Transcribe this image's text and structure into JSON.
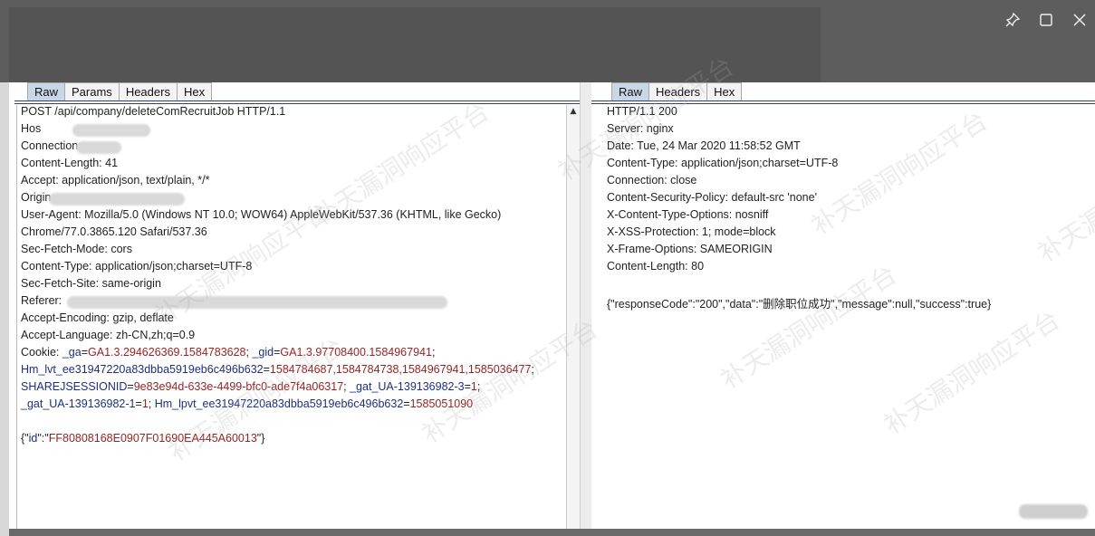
{
  "request_tabs": [
    "Raw",
    "Params",
    "Headers",
    "Hex"
  ],
  "response_tabs": [
    "Raw",
    "Headers",
    "Hex"
  ],
  "request_lines": [
    [
      {
        "t": "POST /api/company/deleteComRecruitJob HTTP/1.1"
      }
    ],
    [
      {
        "t": "Hos"
      }
    ],
    [
      {
        "t": "Connection:"
      }
    ],
    [
      {
        "t": "Content-Length: 41"
      }
    ],
    [
      {
        "t": "Accept: application/json, text/plain, */*"
      }
    ],
    [
      {
        "t": "Origin"
      }
    ],
    [
      {
        "t": "User-Agent: Mozilla/5.0 (Windows NT 10.0; WOW64) AppleWebKit/537.36 (KHTML, like Gecko)"
      }
    ],
    [
      {
        "t": "Chrome/77.0.3865.120 Safari/537.36"
      }
    ],
    [
      {
        "t": "Sec-Fetch-Mode: cors"
      }
    ],
    [
      {
        "t": "Content-Type: application/json;charset=UTF-8"
      }
    ],
    [
      {
        "t": "Sec-Fetch-Site: same-origin"
      }
    ],
    [
      {
        "t": "Referer:"
      }
    ],
    [
      {
        "t": "Accept-Encoding: gzip, deflate"
      }
    ],
    [
      {
        "t": "Accept-Language: zh-CN,zh;q=0.9"
      }
    ],
    [
      {
        "t": "Cookie: "
      },
      {
        "t": "_ga",
        "c": "k"
      },
      {
        "t": "="
      },
      {
        "t": "GA1.3.294626369.1584783628",
        "c": "v"
      },
      {
        "t": "; "
      },
      {
        "t": "_gid",
        "c": "k"
      },
      {
        "t": "="
      },
      {
        "t": "GA1.3.97708400.1584967941",
        "c": "v"
      },
      {
        "t": ";"
      }
    ],
    [
      {
        "t": "Hm_lvt_ee31947220a83dbba5919eb6c496b632",
        "c": "k"
      },
      {
        "t": "="
      },
      {
        "t": "1584784687,1584784738,1584967941,1585036477",
        "c": "v"
      },
      {
        "t": ";"
      }
    ],
    [
      {
        "t": "SHAREJSESSIONID",
        "c": "k"
      },
      {
        "t": "="
      },
      {
        "t": "9e83e94d-633e-4499-bfc0-ade7f4a06317",
        "c": "v"
      },
      {
        "t": "; "
      },
      {
        "t": "_gat_UA-139136982-3",
        "c": "k"
      },
      {
        "t": "="
      },
      {
        "t": "1",
        "c": "v"
      },
      {
        "t": ";"
      }
    ],
    [
      {
        "t": "_gat_UA-139136982-1",
        "c": "k"
      },
      {
        "t": "="
      },
      {
        "t": "1",
        "c": "v"
      },
      {
        "t": "; "
      },
      {
        "t": "Hm_lpvt_ee31947220a83dbba5919eb6c496b632",
        "c": "k"
      },
      {
        "t": "="
      },
      {
        "t": "1585051090",
        "c": "v"
      }
    ],
    [
      {
        "t": ""
      }
    ],
    [
      {
        "t": "{\""
      },
      {
        "t": "id",
        "c": "k"
      },
      {
        "t": "\":\""
      },
      {
        "t": "FF80808168E0907F01690EA445A60013",
        "c": "v"
      },
      {
        "t": "\"}"
      }
    ]
  ],
  "response_lines": [
    "HTTP/1.1 200",
    "Server: nginx",
    "Date: Tue, 24 Mar 2020 11:58:52 GMT",
    "Content-Type: application/json;charset=UTF-8",
    "Connection: close",
    "Content-Security-Policy: default-src 'none'",
    "X-Content-Type-Options: nosniff",
    "X-XSS-Protection: 1; mode=block",
    "X-Frame-Options: SAMEORIGIN",
    "Content-Length: 80",
    "",
    "{\"responseCode\":\"200\",\"data\":\"删除职位成功\",\"message\":null,\"success\":true}"
  ],
  "watermark": "补天漏洞响应平台",
  "window": {
    "pin_icon": "pin-icon",
    "maximize_icon": "maximize-icon",
    "close_icon": "close-icon"
  }
}
